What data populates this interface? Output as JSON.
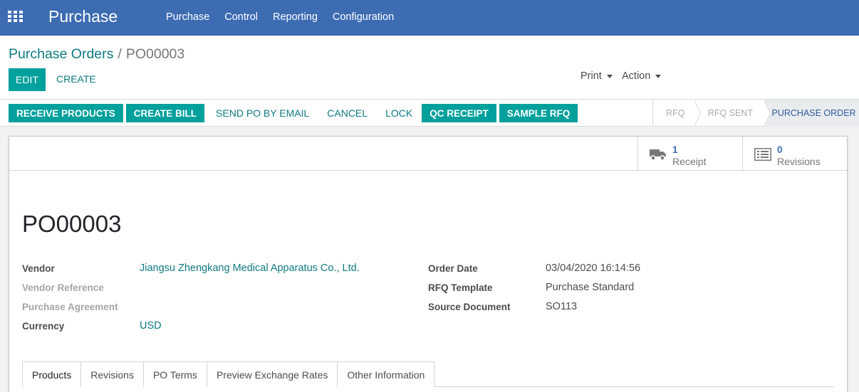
{
  "app": {
    "title": "Purchase",
    "menu": [
      "Purchase",
      "Control",
      "Reporting",
      "Configuration"
    ]
  },
  "breadcrumb": {
    "parent": "Purchase Orders",
    "separator": "/",
    "current": "PO00003"
  },
  "control": {
    "edit_label": "EDIT",
    "create_label": "CREATE",
    "print_label": "Print",
    "action_label": "Action"
  },
  "statusbar": {
    "receive_products": "RECEIVE PRODUCTS",
    "create_bill": "CREATE BILL",
    "send_po_email": "SEND PO BY EMAIL",
    "cancel": "CANCEL",
    "lock": "LOCK",
    "qc_receipt": "QC RECEIPT",
    "sample_rfq": "SAMPLE RFQ",
    "stages": [
      "RFQ",
      "RFQ SENT",
      "PURCHASE ORDER"
    ],
    "active_stage": "PURCHASE ORDER"
  },
  "smart_buttons": {
    "receipt": {
      "count": "1",
      "label": "Receipt",
      "icon": "truck-icon"
    },
    "revisions": {
      "count": "0",
      "label": "Revisions",
      "icon": "list-icon"
    }
  },
  "form": {
    "title": "PO00003",
    "left": [
      {
        "label": "Vendor",
        "value": "Jiangsu Zhengkang Medical Apparatus Co., Ltd."
      },
      {
        "label": "Vendor Reference",
        "value": ""
      },
      {
        "label": "Purchase Agreement",
        "value": ""
      },
      {
        "label": "Currency",
        "value": "USD"
      }
    ],
    "right": [
      {
        "label": "Order Date",
        "value": "03/04/2020 16:14:56"
      },
      {
        "label": "RFQ Template",
        "value": "Purchase Standard"
      },
      {
        "label": "Source Document",
        "value": "SO113"
      }
    ]
  },
  "tabs": [
    "Products",
    "Revisions",
    "PO Terms",
    "Preview Exchange Rates",
    "Other Information"
  ],
  "colors": {
    "navbar": "#3d6cb3",
    "primary_button": "#00a09d",
    "link": "#0e7a82",
    "stat_number": "#3d6cb3"
  }
}
